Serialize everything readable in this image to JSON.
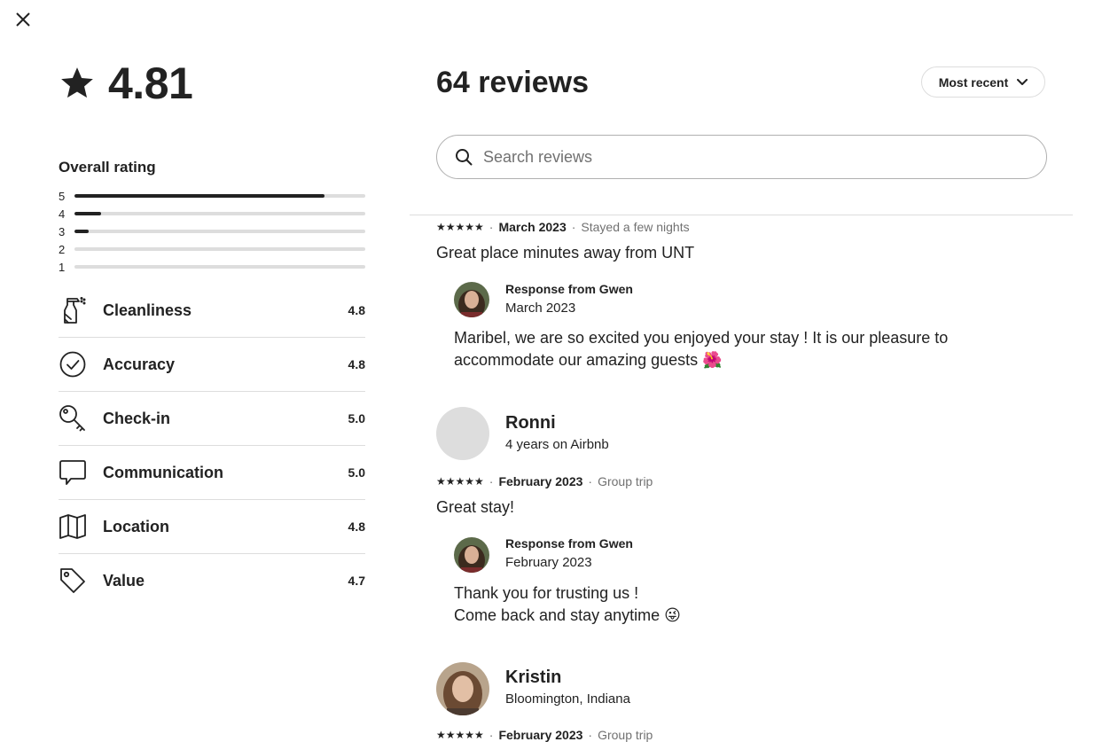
{
  "overall": {
    "rating": "4.81",
    "label": "Overall rating",
    "distribution": [
      {
        "label": "5",
        "fraction": 0.86
      },
      {
        "label": "4",
        "fraction": 0.09
      },
      {
        "label": "3",
        "fraction": 0.05
      },
      {
        "label": "2",
        "fraction": 0
      },
      {
        "label": "1",
        "fraction": 0
      }
    ]
  },
  "categories": [
    {
      "icon": "spray-bottle-icon",
      "label": "Cleanliness",
      "score": "4.8"
    },
    {
      "icon": "check-circle-icon",
      "label": "Accuracy",
      "score": "4.8"
    },
    {
      "icon": "key-icon",
      "label": "Check-in",
      "score": "5.0"
    },
    {
      "icon": "speech-bubble-icon",
      "label": "Communication",
      "score": "5.0"
    },
    {
      "icon": "map-icon",
      "label": "Location",
      "score": "4.8"
    },
    {
      "icon": "tag-icon",
      "label": "Value",
      "score": "4.7"
    }
  ],
  "reviews_header": {
    "title": "64 reviews",
    "sort_label": "Most recent",
    "search_placeholder": "Search reviews"
  },
  "reviews": [
    {
      "stars": "★★★★★",
      "date": "March 2023",
      "trip": "Stayed a few nights",
      "text": "Great place minutes away from UNT",
      "response": {
        "heading": "Response from Gwen",
        "date": "March 2023",
        "text_lines": [
          "Maribel, we are so excited you enjoyed your stay ! It is our pleasure to",
          "accommodate our amazing guests 🌺"
        ]
      }
    },
    {
      "user": {
        "name": "Ronni",
        "sub": "4 years on Airbnb"
      },
      "stars": "★★★★★",
      "date": "February 2023",
      "trip": "Group trip",
      "text": "Great stay!",
      "response": {
        "heading": "Response from Gwen",
        "date": "February 2023",
        "text_lines": [
          "Thank you for trusting us !",
          "Come back and stay anytime 😜"
        ]
      }
    },
    {
      "user": {
        "name": "Kristin",
        "sub": "Bloomington, Indiana"
      },
      "stars": "★★★★★",
      "date": "February 2023",
      "trip": "Group trip"
    }
  ],
  "sep": "·"
}
